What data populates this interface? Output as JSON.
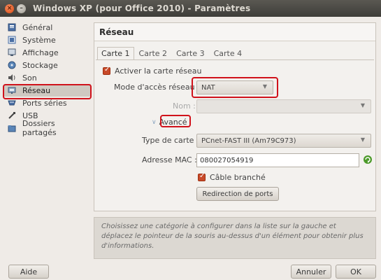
{
  "window": {
    "title": "Windows XP (pour Office 2010) - Paramètres"
  },
  "sidebar": {
    "items": [
      {
        "label": "Général",
        "icon": "general-icon"
      },
      {
        "label": "Système",
        "icon": "system-icon"
      },
      {
        "label": "Affichage",
        "icon": "display-icon"
      },
      {
        "label": "Stockage",
        "icon": "storage-icon"
      },
      {
        "label": "Son",
        "icon": "sound-icon"
      },
      {
        "label": "Réseau",
        "icon": "network-icon"
      },
      {
        "label": "Ports séries",
        "icon": "serial-ports-icon"
      },
      {
        "label": "USB",
        "icon": "usb-icon"
      },
      {
        "label": "Dossiers partagés",
        "icon": "shared-folders-icon"
      }
    ],
    "selected": "Réseau"
  },
  "panel": {
    "title": "Réseau",
    "tabs": [
      "Carte 1",
      "Carte 2",
      "Carte 3",
      "Carte 4"
    ],
    "active_tab": "Carte 1",
    "enable_label": "Activer la carte réseau",
    "mode_label": "Mode d'accès réseau :",
    "mode_value": "NAT",
    "name_label": "Nom :",
    "name_value": "",
    "advanced_label": "Avancé",
    "card_type_label": "Type de carte :",
    "card_type_value": "PCnet-FAST III (Am79C973)",
    "mac_label": "Adresse MAC :",
    "mac_value": "080027054919",
    "cable_label": "Câble branché",
    "port_forward_label": "Redirection de ports"
  },
  "info": {
    "text": "Choisissez une catégorie à configurer dans la liste sur la gauche et déplacez le pointeur de la souris au-dessus d'un élément pour obtenir plus d'informations."
  },
  "buttons": {
    "help": "Aide",
    "cancel": "Annuler",
    "ok": "OK"
  },
  "colors": {
    "highlight": "#d0121b",
    "titlebar": "#3e3d39",
    "checkbox": "#c84a2a"
  }
}
